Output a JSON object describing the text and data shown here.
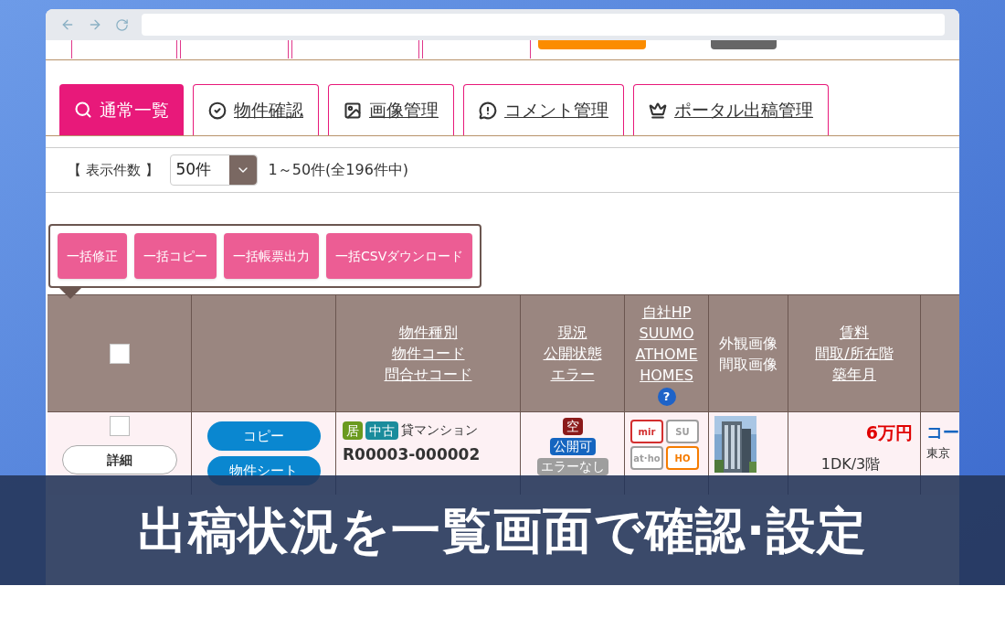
{
  "tabs": [
    {
      "label": "通常一覧",
      "selected": true
    },
    {
      "label": "物件確認",
      "selected": false
    },
    {
      "label": "画像管理",
      "selected": false
    },
    {
      "label": "コメント管理",
      "selected": false
    },
    {
      "label": "ポータル出稿管理",
      "selected": false
    }
  ],
  "display_count": {
    "label": "【 表示件数 】",
    "value": "50件",
    "summary": "1～50件(全196件中)"
  },
  "bulk_buttons": [
    "一括修正",
    "一括コピー",
    "一括帳票出力",
    "一括CSVダウンロード"
  ],
  "table": {
    "select_all_checked": false,
    "columns": [
      {
        "kind": "checkbox"
      },
      {
        "kind": "empty"
      },
      {
        "kind": "link",
        "lines": [
          "物件種別",
          "物件コード",
          "問合せコード"
        ]
      },
      {
        "kind": "link",
        "lines": [
          "現況",
          "公開状態",
          "エラー"
        ]
      },
      {
        "kind": "link",
        "lines": [
          "自社HP",
          "SUUMO",
          "ATHOME",
          "HOMES"
        ],
        "help": "?"
      },
      {
        "kind": "text",
        "lines": [
          "外観画像",
          "間取画像"
        ]
      },
      {
        "kind": "link",
        "lines": [
          "賃料",
          "間取/所在階",
          "築年月"
        ]
      }
    ],
    "rows": [
      {
        "checked": false,
        "detail": "詳細",
        "actions": [
          "コピー",
          "物件シート"
        ],
        "tags": [
          {
            "text": "居",
            "color": "#6a9a1f"
          },
          {
            "text": "中古",
            "color": "#1a8c9c"
          }
        ],
        "type": "貸マンション",
        "code": "R00003-000002",
        "status": [
          {
            "text": "空",
            "color": "#8b1a1a"
          },
          {
            "text": "公開可",
            "color": "#1565c0"
          },
          {
            "text": "エラーなし",
            "color": "#9e9e9e"
          }
        ],
        "portals": [
          {
            "text": "mir",
            "color": "#d32f2f"
          },
          {
            "text": "SU",
            "color": "#9e9e9e"
          },
          {
            "text": "at·ho",
            "color": "#9e9e9e"
          },
          {
            "text": "HO",
            "color": "#f57c00"
          }
        ],
        "image": {
          "kind": "picture"
        },
        "rent": "6万円",
        "layout": "1DK/3階",
        "name": "コー",
        "address": "東京"
      }
    ]
  },
  "banner": "出稿状況を一覧画面で確認·設定"
}
